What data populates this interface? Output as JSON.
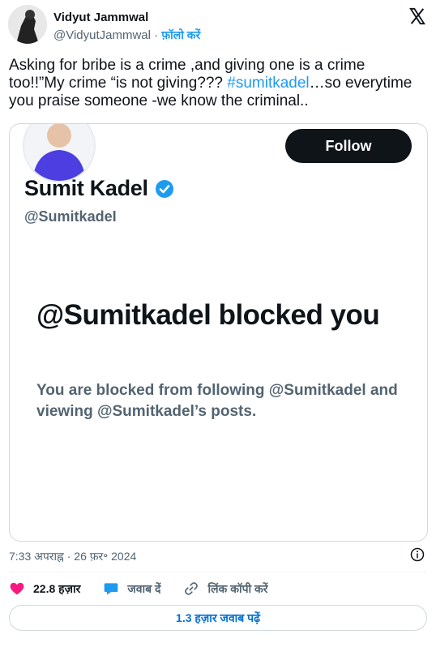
{
  "author": {
    "name": "Vidyut Jammwal",
    "handle": "@VidyutJammwal",
    "separator": "·",
    "follow_label": "फ़ॉलो करें"
  },
  "tweet": {
    "text_before": "Asking for bribe is a crime ,and giving one is a crime too!!”My crime “is  not giving??? ",
    "hashtag": "#sumitkadel",
    "text_after": "…so everytime you praise someone -we know the criminal.."
  },
  "media": {
    "name": "Sumit Kadel",
    "handle": "@SumitkadeI",
    "follow_label": "Follow",
    "blocked_title": "@Sumitkadel blocked you",
    "blocked_sub": "You are blocked from following @Sumitkadel and viewing @Sumitkadel’s posts."
  },
  "timestamp": "7:33 अपराह्न · 26 फ़र॰ 2024",
  "actions": {
    "like_count": "22.8 हज़ार",
    "reply_label": "जवाब दें",
    "copy_label": "लिंक कॉपी करें"
  },
  "read_replies_label": "1.3 हज़ार जवाब पढ़ें",
  "colors": {
    "link": "#1d9bf0",
    "like": "#f91880",
    "verified": "#1d9bf0"
  }
}
